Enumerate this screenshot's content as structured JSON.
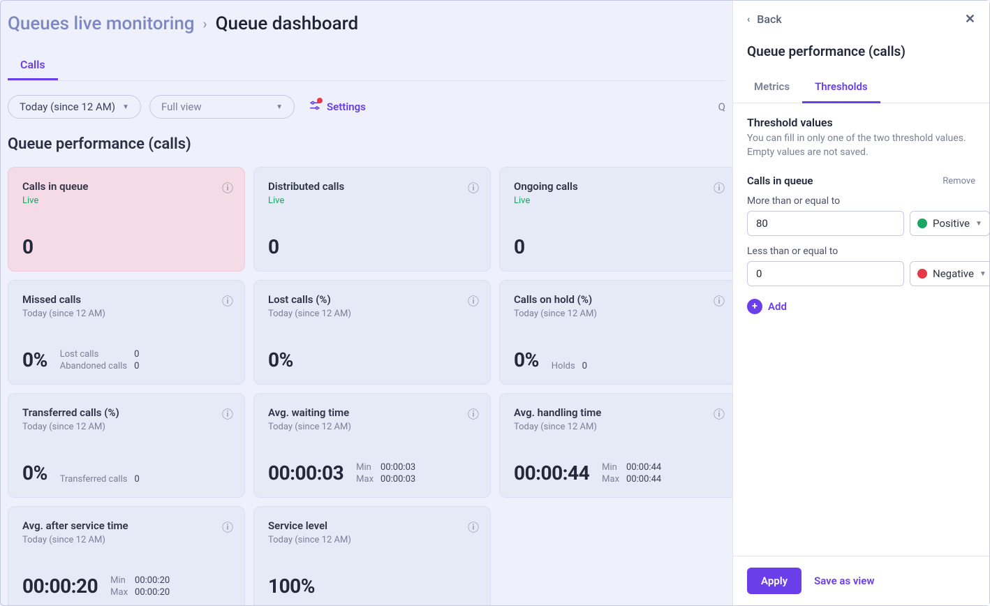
{
  "breadcrumb": {
    "previous": "Queues live monitoring",
    "current": "Queue dashboard"
  },
  "primary_tab": "Calls",
  "toolbar": {
    "time_range": "Today (since 12 AM)",
    "view_mode": "Full view",
    "settings": "Settings",
    "truncated_right": "Q"
  },
  "section_title": "Queue performance (calls)",
  "cards": {
    "calls_in_queue": {
      "title": "Calls in queue",
      "sub": "Live",
      "value": "0"
    },
    "distributed_calls": {
      "title": "Distributed calls",
      "sub": "Live",
      "value": "0"
    },
    "ongoing_calls": {
      "title": "Ongoing calls",
      "sub": "Live",
      "value": "0"
    },
    "missed_calls": {
      "title": "Missed calls",
      "sub": "Today (since 12 AM)",
      "value": "0%",
      "mini": [
        [
          "Lost calls",
          "0"
        ],
        [
          "Abandoned calls",
          "0"
        ]
      ]
    },
    "lost_calls_pct": {
      "title": "Lost calls (%)",
      "sub": "Today (since 12 AM)",
      "value": "0%"
    },
    "calls_on_hold_pct": {
      "title": "Calls on hold (%)",
      "sub": "Today (since 12 AM)",
      "value": "0%",
      "mini": [
        [
          "Holds",
          "0"
        ]
      ]
    },
    "transferred_pct": {
      "title": "Transferred calls (%)",
      "sub": "Today (since 12 AM)",
      "value": "0%",
      "mini": [
        [
          "Transferred calls",
          "0"
        ]
      ]
    },
    "avg_waiting": {
      "title": "Avg. waiting time",
      "sub": "Today (since 12 AM)",
      "value": "00:00:03",
      "mini": [
        [
          "Min",
          "00:00:03"
        ],
        [
          "Max",
          "00:00:03"
        ]
      ]
    },
    "avg_handling": {
      "title": "Avg. handling time",
      "sub": "Today (since 12 AM)",
      "value": "00:00:44",
      "mini": [
        [
          "Min",
          "00:00:44"
        ],
        [
          "Max",
          "00:00:44"
        ]
      ]
    },
    "avg_after_service": {
      "title": "Avg. after service time",
      "sub": "Today (since 12 AM)",
      "value": "00:00:20",
      "mini": [
        [
          "Min",
          "00:00:20"
        ],
        [
          "Max",
          "00:00:20"
        ]
      ]
    },
    "service_level": {
      "title": "Service level",
      "sub": "Today (since 12 AM)",
      "value": "100%"
    }
  },
  "sidebar": {
    "back": "Back",
    "title": "Queue performance (calls)",
    "tabs": {
      "metrics": "Metrics",
      "thresholds": "Thresholds"
    },
    "threshold_heading": "Threshold values",
    "threshold_help": "You can fill in only one of the two threshold values. Empty values are not saved.",
    "metric_label": "Calls in queue",
    "remove": "Remove",
    "gte_label": "More than or equal to",
    "gte_value": "80",
    "gte_status": "Positive",
    "lte_label": "Less than or equal to",
    "lte_value": "0",
    "lte_status": "Negative",
    "add": "Add",
    "apply": "Apply",
    "save_as_view": "Save as view"
  }
}
